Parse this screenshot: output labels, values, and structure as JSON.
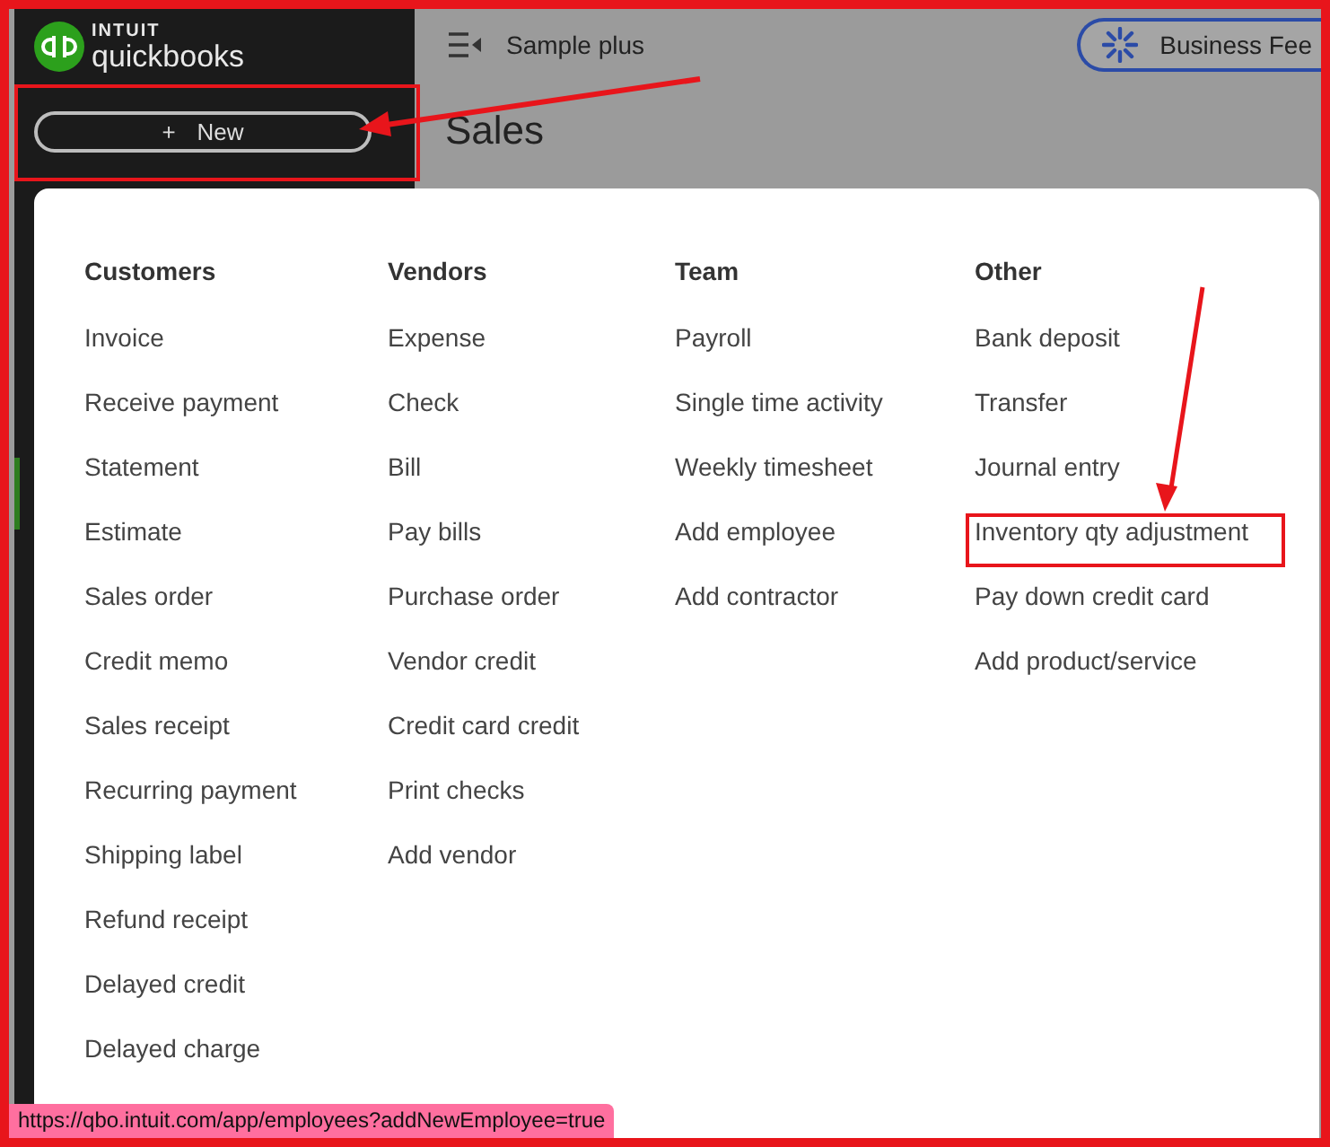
{
  "sidebar": {
    "logo_brand": "INTUIT",
    "logo_product": "quickbooks",
    "new_button": {
      "label": "New",
      "icon": "+",
      "highlighted": true
    }
  },
  "header": {
    "company": "Sample plus",
    "feed_button": "Business Fee"
  },
  "page_title": "Sales",
  "new_menu": {
    "columns": [
      {
        "heading": "Customers",
        "items": [
          {
            "label": "Invoice",
            "highlighted": false
          },
          {
            "label": "Receive payment",
            "highlighted": false
          },
          {
            "label": "Statement",
            "highlighted": false
          },
          {
            "label": "Estimate",
            "highlighted": false
          },
          {
            "label": "Sales order",
            "highlighted": false
          },
          {
            "label": "Credit memo",
            "highlighted": false
          },
          {
            "label": "Sales receipt",
            "highlighted": false
          },
          {
            "label": "Recurring payment",
            "highlighted": false
          },
          {
            "label": "Shipping label",
            "highlighted": false
          },
          {
            "label": "Refund receipt",
            "highlighted": false
          },
          {
            "label": "Delayed credit",
            "highlighted": false
          },
          {
            "label": "Delayed charge",
            "highlighted": false
          }
        ]
      },
      {
        "heading": "Vendors",
        "items": [
          {
            "label": "Expense",
            "highlighted": false
          },
          {
            "label": "Check",
            "highlighted": false
          },
          {
            "label": "Bill",
            "highlighted": false
          },
          {
            "label": "Pay bills",
            "highlighted": false
          },
          {
            "label": "Purchase order",
            "highlighted": false
          },
          {
            "label": "Vendor credit",
            "highlighted": false
          },
          {
            "label": "Credit card credit",
            "highlighted": false
          },
          {
            "label": "Print checks",
            "highlighted": false
          },
          {
            "label": "Add vendor",
            "highlighted": false
          }
        ]
      },
      {
        "heading": "Team",
        "items": [
          {
            "label": "Payroll",
            "highlighted": false
          },
          {
            "label": "Single time activity",
            "highlighted": false
          },
          {
            "label": "Weekly timesheet",
            "highlighted": false
          },
          {
            "label": "Add employee",
            "highlighted": false
          },
          {
            "label": "Add contractor",
            "highlighted": false
          }
        ]
      },
      {
        "heading": "Other",
        "items": [
          {
            "label": "Bank deposit",
            "highlighted": false
          },
          {
            "label": "Transfer",
            "highlighted": false
          },
          {
            "label": "Journal entry",
            "highlighted": false
          },
          {
            "label": "Inventory qty adjustment",
            "highlighted": true
          },
          {
            "label": "Pay down credit card",
            "highlighted": false
          },
          {
            "label": "Add product/service",
            "highlighted": false
          }
        ]
      }
    ]
  },
  "status_bar": {
    "url": "https://qbo.intuit.com/app/employees?addNewEmployee=true"
  }
}
